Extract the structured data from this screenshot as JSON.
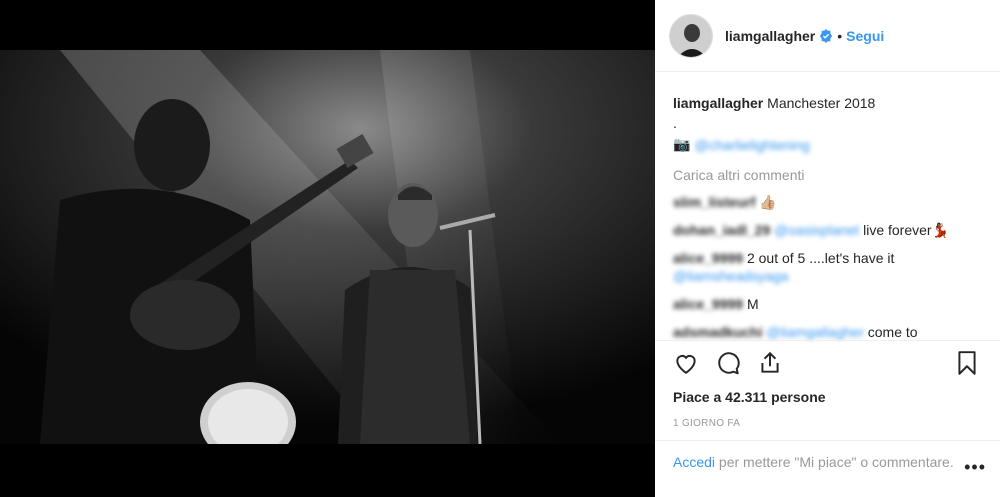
{
  "post": {
    "username": "liamgallagher",
    "follow_label": "Segui",
    "separator": "•",
    "caption_username": "liamgallagher",
    "caption_text": "Manchester 2018",
    "caption_dot": ".",
    "caption_credit_handle": "@charlielightening",
    "load_more_label": "Carica altri commenti",
    "comments": [
      {
        "user": "slim_listeurf",
        "text": "👍🏼",
        "mention": ""
      },
      {
        "user": "dohan_iadl_29",
        "mention": "@oasisplanet",
        "text": " live forever💃🏾"
      },
      {
        "user": "alice_9999",
        "mention": "",
        "text": "2 out of 5 ....let's have it"
      },
      {
        "user": "",
        "mention": "@liamsheadsyaga",
        "text": ""
      },
      {
        "user": "alice_9999",
        "mention": "",
        "text": "M"
      },
      {
        "user": "adsmadkuchi",
        "mention": "@liamgallagher",
        "text": " come to"
      }
    ],
    "likes_text": "Piace a 42.311 persone",
    "timestamp": "1 GIORNO FA",
    "login_link": "Accedi",
    "login_text": " per mettere \"Mi piace\" o commentare.",
    "more_label": "•••"
  },
  "icons": {
    "heart": "heart-icon",
    "comment": "comment-icon",
    "share": "share-icon",
    "save": "bookmark-icon",
    "verified": "verified-badge-icon",
    "camera": "camera-icon"
  },
  "colors": {
    "link": "#3897f0",
    "text": "#262626",
    "muted": "#999999",
    "photo_bg": "#000000"
  }
}
